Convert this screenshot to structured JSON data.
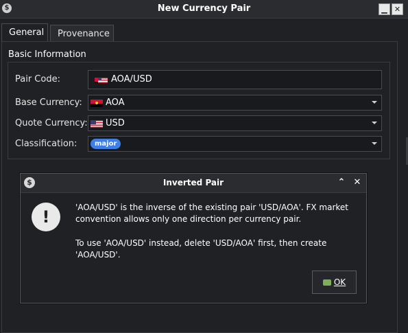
{
  "window": {
    "title": "New Currency Pair",
    "minimize_glyph": "▁",
    "close_glyph": "✕"
  },
  "tabs": [
    {
      "label": "General",
      "active": true
    },
    {
      "label": "Provenance",
      "active": false
    }
  ],
  "basic_info": {
    "section_title": "Basic Information",
    "pair_code_label": "Pair Code:",
    "pair_code_value": "AOA/USD",
    "base_currency_label": "Base Currency:",
    "base_currency_value": "AOA",
    "quote_currency_label": "Quote Currency:",
    "quote_currency_value": "USD",
    "classification_label": "Classification:",
    "classification_value": "major",
    "badge_color": "#3d7fe6"
  },
  "dialog": {
    "title": "Inverted Pair",
    "icon": "dollar-icon",
    "warning_glyph": "!",
    "message_1": "'AOA/USD' is the inverse of the existing pair 'USD/AOA'. FX market convention allows only one direction per currency pair.",
    "message_2": "To use 'AOA/USD' instead, delete 'USD/AOA' first, then create 'AOA/USD'.",
    "ok_label": "OK"
  }
}
